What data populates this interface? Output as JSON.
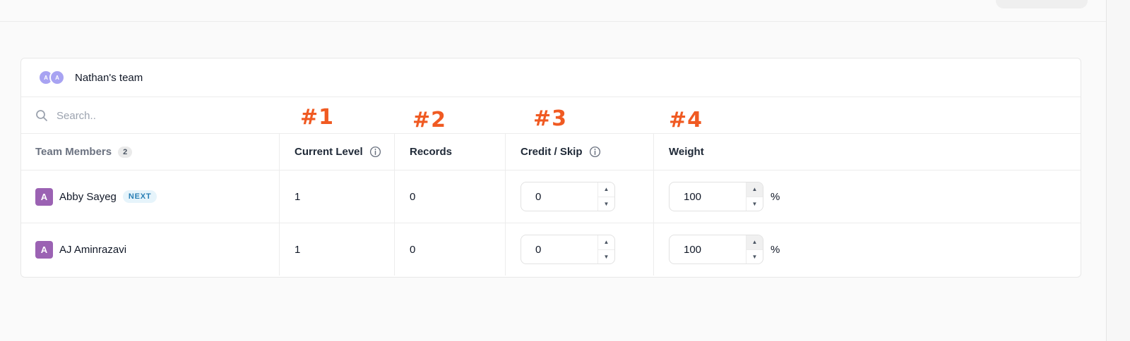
{
  "team": {
    "name": "Nathan's team",
    "avatars": [
      "A",
      "A"
    ]
  },
  "search": {
    "placeholder": "Search.."
  },
  "annotations": [
    "#1",
    "#2",
    "#3",
    "#4"
  ],
  "table": {
    "headers": {
      "team_members": "Team Members",
      "member_count": "2",
      "current_level": "Current Level",
      "records": "Records",
      "credit_skip": "Credit / Skip",
      "weight": "Weight"
    },
    "rows": [
      {
        "initial": "A",
        "name": "Abby Sayeg",
        "badge": "NEXT",
        "current_level": "1",
        "records": "0",
        "credit_skip": "0",
        "weight": "100",
        "weight_unit": "%"
      },
      {
        "initial": "A",
        "name": "AJ Aminrazavi",
        "badge": "",
        "current_level": "1",
        "records": "0",
        "credit_skip": "0",
        "weight": "100",
        "weight_unit": "%"
      }
    ]
  },
  "icons": {
    "search": "search-icon",
    "info": "info-icon",
    "step_up": "caret-up-icon",
    "step_down": "caret-down-icon"
  },
  "colors": {
    "annotation": "#f05a22",
    "user_avatar": "#9b62b3",
    "team_avatar": "#a8a3f2",
    "next_badge_bg": "#e6f4fb",
    "next_badge_text": "#2a7fb5"
  }
}
